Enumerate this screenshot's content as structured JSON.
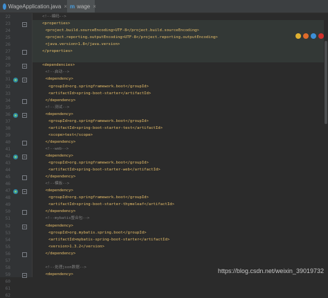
{
  "tabs": [
    {
      "label": "WageApplication.java",
      "icon": "java-class-icon"
    },
    {
      "label": "wage",
      "icon": "maven-icon",
      "prefix": "m"
    }
  ],
  "close_glyph": "×",
  "watermark": "https://blog.csdn.net/weixin_39019732",
  "browser_icons": [
    "chrome-icon",
    "firefox-icon",
    "safari-icon",
    "opera-icon"
  ],
  "colors": {
    "tag": "#e8bf6a",
    "text": "#a9b7c6",
    "comment": "#808080",
    "background": "#2b2b2b"
  },
  "line_numbers": [
    "22",
    "23",
    "24",
    "25",
    "26",
    "27",
    "28",
    "29",
    "30",
    "31",
    "32",
    "33",
    "34",
    "35",
    "36",
    "37",
    "38",
    "39",
    "40",
    "41",
    "42",
    "43",
    "44",
    "45",
    "46",
    "47",
    "48",
    "49",
    "50",
    "51",
    "52",
    "53",
    "54",
    "55",
    "56",
    "57",
    "58",
    "59",
    "60",
    "61",
    "62"
  ],
  "code_lines": [
    {
      "text": "<!--编码-->",
      "kind": "comment"
    },
    {
      "text": "<properties>",
      "kind": "tag"
    },
    {
      "text": "<project.build.sourceEncoding>UTF-8</project.build.sourceEncoding>",
      "kind": "tag"
    },
    {
      "text": "<project.reporting.outputEncoding>UTF-8</project.reporting.outputEncoding>",
      "kind": "tag"
    },
    {
      "text": "<java.version>1.8</java.version>",
      "kind": "tag"
    },
    {
      "text": "</properties>",
      "kind": "tag"
    },
    {
      "text": "",
      "kind": "tag"
    },
    {
      "text": "<dependencies>",
      "kind": "tag"
    },
    {
      "text": "<!--启动-->",
      "kind": "comment"
    },
    {
      "text": "<dependency>",
      "kind": "tag"
    },
    {
      "text": "<groupId>org.springframework.boot</groupId>",
      "kind": "tag"
    },
    {
      "text": "<artifactId>spring-boot-starter</artifactId>",
      "kind": "tag"
    },
    {
      "text": "</dependency>",
      "kind": "tag"
    },
    {
      "text": "<!--测试-->",
      "kind": "comment"
    },
    {
      "text": "<dependency>",
      "kind": "tag"
    },
    {
      "text": "<groupId>org.springframework.boot</groupId>",
      "kind": "tag"
    },
    {
      "text": "<artifactId>spring-boot-starter-test</artifactId>",
      "kind": "tag"
    },
    {
      "text": "<scope>test</scope>",
      "kind": "tag"
    },
    {
      "text": "</dependency>",
      "kind": "tag"
    },
    {
      "text": "<!--web-->",
      "kind": "comment"
    },
    {
      "text": "<dependency>",
      "kind": "tag"
    },
    {
      "text": "<groupId>org.springframework.boot</groupId>",
      "kind": "tag"
    },
    {
      "text": "<artifactId>spring-boot-starter-web</artifactId>",
      "kind": "tag"
    },
    {
      "text": "</dependency>",
      "kind": "tag"
    },
    {
      "text": "<!--模板-->",
      "kind": "comment"
    },
    {
      "text": "<dependency>",
      "kind": "tag"
    },
    {
      "text": "<groupId>org.springframework.boot</groupId>",
      "kind": "tag"
    },
    {
      "text": "<artifactId>spring-boot-starter-thymeleaf</artifactId>",
      "kind": "tag"
    },
    {
      "text": "</dependency>",
      "kind": "tag"
    },
    {
      "text": "<!--mybatis整合包-->",
      "kind": "comment"
    },
    {
      "text": "<dependency>",
      "kind": "tag"
    },
    {
      "text": "<groupId>org.mybatis.spring.boot</groupId>",
      "kind": "tag"
    },
    {
      "text": "<artifactId>mybatis-spring-boot-starter</artifactId>",
      "kind": "tag"
    },
    {
      "text": "<version>1.3.2</version>",
      "kind": "tag"
    },
    {
      "text": "</dependency>",
      "kind": "tag"
    },
    {
      "text": "",
      "kind": "tag"
    },
    {
      "text": "<!--处理json数据-->",
      "kind": "comment"
    },
    {
      "text": "<dependency>",
      "kind": "tag"
    }
  ]
}
